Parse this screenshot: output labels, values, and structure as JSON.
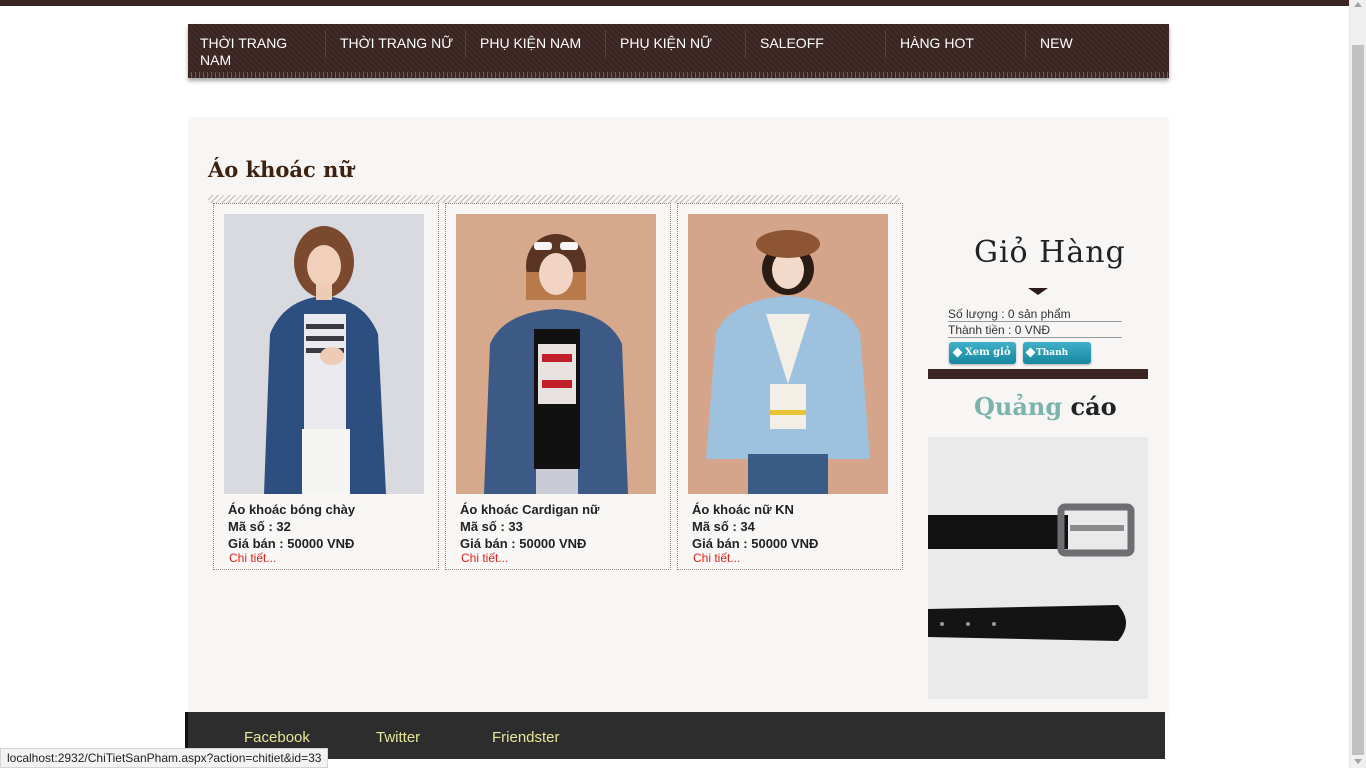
{
  "nav": {
    "items": [
      {
        "label": "THỜI TRANG NAM"
      },
      {
        "label": "THỜI TRANG NỮ"
      },
      {
        "label": "PHỤ KIỆN NAM"
      },
      {
        "label": "PHỤ KIỆN NỮ"
      },
      {
        "label": "SALEOFF"
      },
      {
        "label": "HÀNG HOT"
      },
      {
        "label": "NEW"
      }
    ]
  },
  "category": {
    "title": "Áo khoác nữ"
  },
  "products": [
    {
      "name": "Áo khoác bóng chày",
      "code": "Mã số : 32",
      "price": "Giá bán : 50000 VNĐ",
      "detail": "Chi tiết..."
    },
    {
      "name": "Áo khoác Cardigan nữ",
      "code": "Mã số : 33",
      "price": "Giá bán : 50000 VNĐ",
      "detail": "Chi tiết..."
    },
    {
      "name": "Áo khoác nữ KN",
      "code": "Mã số : 34",
      "price": "Giá bán : 50000 VNĐ",
      "detail": "Chi tiết..."
    }
  ],
  "cart": {
    "title": "Giỏ Hàng",
    "quantity": "Số lượng : 0 sản phẩm",
    "total": "Thành tiền : 0 VNĐ",
    "view_button": "Xem giỏ",
    "checkout_button": "Thanh toán"
  },
  "ads": {
    "title_part1": "Quảng",
    "title_part2": "cáo"
  },
  "footer": {
    "links": [
      "Facebook",
      "Twitter",
      "Friendster"
    ]
  },
  "status_url": "localhost:2932/ChiTietSanPham.aspx?action=chitiet&id=33",
  "colors": {
    "nav_bg": "#3b2522",
    "link_red": "#e0201b",
    "footer_link": "#e7e69a",
    "button": "#1f96b0"
  }
}
